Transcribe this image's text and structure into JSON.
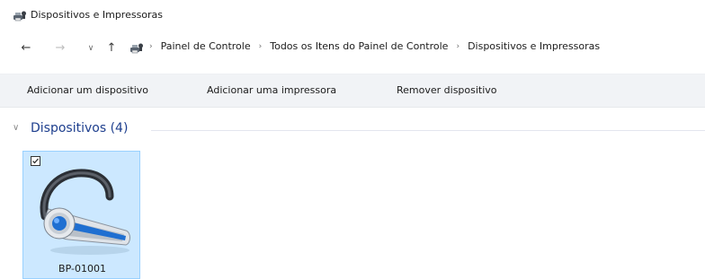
{
  "window": {
    "title": "Dispositivos e Impressoras",
    "title_icon": "devices-printers-icon"
  },
  "navigation": {
    "back_icon": "back-arrow-icon",
    "forward_icon": "forward-arrow-icon",
    "recent_icon": "chevron-down-icon",
    "up_icon": "up-arrow-icon",
    "location_icon": "devices-printers-icon",
    "breadcrumbs": [
      {
        "label": "Painel de Controle"
      },
      {
        "label": "Todos os Itens do Painel de Controle"
      },
      {
        "label": "Dispositivos e Impressoras"
      }
    ]
  },
  "commandbar": {
    "add_device": "Adicionar um dispositivo",
    "add_printer": "Adicionar uma impressora",
    "remove_device": "Remover dispositivo"
  },
  "group": {
    "title": "Dispositivos (4)",
    "expanded": true
  },
  "devices": [
    {
      "name": "BP-01001",
      "icon": "bluetooth-headset-icon",
      "selected": true,
      "checked": true
    }
  ],
  "colors": {
    "selection_fill": "#cce8ff",
    "selection_border": "#99d1ff",
    "group_title": "#1e3f8e",
    "commandbar_bg": "#f1f3f6"
  }
}
